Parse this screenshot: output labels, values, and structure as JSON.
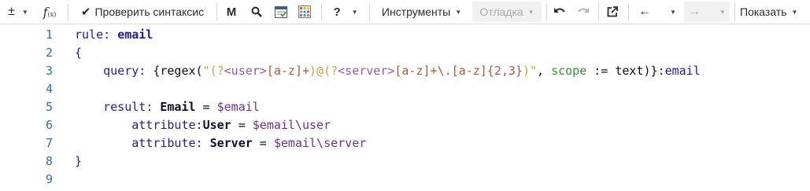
{
  "toolbar": {
    "plusminus_label": "±",
    "fx_label": "f",
    "fx_sub": "(x)",
    "check_syntax_label": "Проверить синтаксис",
    "m_label": "M",
    "help_label": "?",
    "tools_label": "Инструменты",
    "debug_label": "Отладка",
    "show_label": "Показать"
  },
  "editor": {
    "line_numbers": [
      "1",
      "2",
      "3",
      "4",
      "5",
      "6",
      "7",
      "8",
      "9"
    ],
    "lines": [
      {
        "parts": [
          "rule",
          ": ",
          "email"
        ]
      },
      {
        "parts": [
          "{"
        ]
      },
      {
        "parts": [
          "    query",
          ": ",
          "{",
          "regex",
          "(",
          "\"(?",
          "<user>",
          "[a-z]+",
          ")@(",
          "?",
          "<server>",
          "[a-z]+\\.[a-z]{2,3}",
          ")\"",
          ", ",
          "scope",
          " := ",
          "text",
          ")}",
          ":email"
        ]
      },
      {
        "parts": [
          ""
        ]
      },
      {
        "parts": [
          "    result",
          ": ",
          "Email",
          " = ",
          "$email"
        ]
      },
      {
        "parts": [
          "        attribute",
          ":",
          "User",
          " = ",
          "$email\\user"
        ]
      },
      {
        "parts": [
          "        attribute",
          ": ",
          "Server",
          " = ",
          "$email\\server"
        ]
      },
      {
        "parts": [
          "}"
        ]
      },
      {
        "parts": [
          ""
        ]
      }
    ]
  }
}
